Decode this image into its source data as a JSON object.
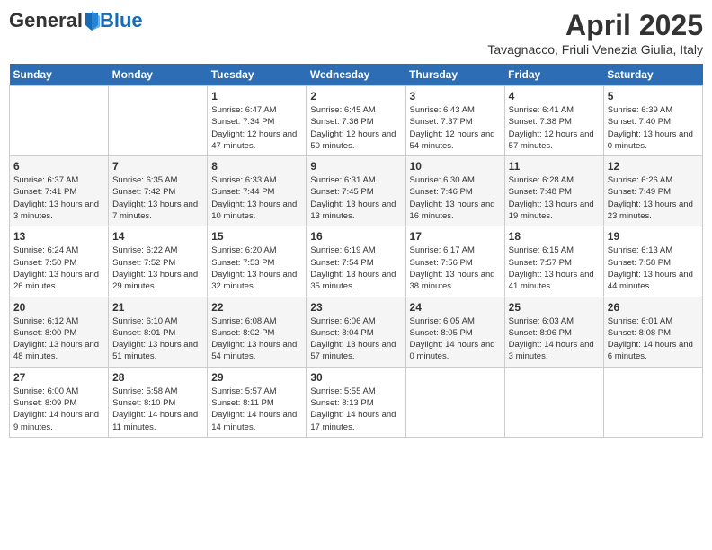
{
  "header": {
    "logo_general": "General",
    "logo_blue": "Blue",
    "month": "April 2025",
    "location": "Tavagnacco, Friuli Venezia Giulia, Italy"
  },
  "days_of_week": [
    "Sunday",
    "Monday",
    "Tuesday",
    "Wednesday",
    "Thursday",
    "Friday",
    "Saturday"
  ],
  "weeks": [
    [
      {
        "day": "",
        "info": ""
      },
      {
        "day": "",
        "info": ""
      },
      {
        "day": "1",
        "info": "Sunrise: 6:47 AM\nSunset: 7:34 PM\nDaylight: 12 hours and 47 minutes."
      },
      {
        "day": "2",
        "info": "Sunrise: 6:45 AM\nSunset: 7:36 PM\nDaylight: 12 hours and 50 minutes."
      },
      {
        "day": "3",
        "info": "Sunrise: 6:43 AM\nSunset: 7:37 PM\nDaylight: 12 hours and 54 minutes."
      },
      {
        "day": "4",
        "info": "Sunrise: 6:41 AM\nSunset: 7:38 PM\nDaylight: 12 hours and 57 minutes."
      },
      {
        "day": "5",
        "info": "Sunrise: 6:39 AM\nSunset: 7:40 PM\nDaylight: 13 hours and 0 minutes."
      }
    ],
    [
      {
        "day": "6",
        "info": "Sunrise: 6:37 AM\nSunset: 7:41 PM\nDaylight: 13 hours and 3 minutes."
      },
      {
        "day": "7",
        "info": "Sunrise: 6:35 AM\nSunset: 7:42 PM\nDaylight: 13 hours and 7 minutes."
      },
      {
        "day": "8",
        "info": "Sunrise: 6:33 AM\nSunset: 7:44 PM\nDaylight: 13 hours and 10 minutes."
      },
      {
        "day": "9",
        "info": "Sunrise: 6:31 AM\nSunset: 7:45 PM\nDaylight: 13 hours and 13 minutes."
      },
      {
        "day": "10",
        "info": "Sunrise: 6:30 AM\nSunset: 7:46 PM\nDaylight: 13 hours and 16 minutes."
      },
      {
        "day": "11",
        "info": "Sunrise: 6:28 AM\nSunset: 7:48 PM\nDaylight: 13 hours and 19 minutes."
      },
      {
        "day": "12",
        "info": "Sunrise: 6:26 AM\nSunset: 7:49 PM\nDaylight: 13 hours and 23 minutes."
      }
    ],
    [
      {
        "day": "13",
        "info": "Sunrise: 6:24 AM\nSunset: 7:50 PM\nDaylight: 13 hours and 26 minutes."
      },
      {
        "day": "14",
        "info": "Sunrise: 6:22 AM\nSunset: 7:52 PM\nDaylight: 13 hours and 29 minutes."
      },
      {
        "day": "15",
        "info": "Sunrise: 6:20 AM\nSunset: 7:53 PM\nDaylight: 13 hours and 32 minutes."
      },
      {
        "day": "16",
        "info": "Sunrise: 6:19 AM\nSunset: 7:54 PM\nDaylight: 13 hours and 35 minutes."
      },
      {
        "day": "17",
        "info": "Sunrise: 6:17 AM\nSunset: 7:56 PM\nDaylight: 13 hours and 38 minutes."
      },
      {
        "day": "18",
        "info": "Sunrise: 6:15 AM\nSunset: 7:57 PM\nDaylight: 13 hours and 41 minutes."
      },
      {
        "day": "19",
        "info": "Sunrise: 6:13 AM\nSunset: 7:58 PM\nDaylight: 13 hours and 44 minutes."
      }
    ],
    [
      {
        "day": "20",
        "info": "Sunrise: 6:12 AM\nSunset: 8:00 PM\nDaylight: 13 hours and 48 minutes."
      },
      {
        "day": "21",
        "info": "Sunrise: 6:10 AM\nSunset: 8:01 PM\nDaylight: 13 hours and 51 minutes."
      },
      {
        "day": "22",
        "info": "Sunrise: 6:08 AM\nSunset: 8:02 PM\nDaylight: 13 hours and 54 minutes."
      },
      {
        "day": "23",
        "info": "Sunrise: 6:06 AM\nSunset: 8:04 PM\nDaylight: 13 hours and 57 minutes."
      },
      {
        "day": "24",
        "info": "Sunrise: 6:05 AM\nSunset: 8:05 PM\nDaylight: 14 hours and 0 minutes."
      },
      {
        "day": "25",
        "info": "Sunrise: 6:03 AM\nSunset: 8:06 PM\nDaylight: 14 hours and 3 minutes."
      },
      {
        "day": "26",
        "info": "Sunrise: 6:01 AM\nSunset: 8:08 PM\nDaylight: 14 hours and 6 minutes."
      }
    ],
    [
      {
        "day": "27",
        "info": "Sunrise: 6:00 AM\nSunset: 8:09 PM\nDaylight: 14 hours and 9 minutes."
      },
      {
        "day": "28",
        "info": "Sunrise: 5:58 AM\nSunset: 8:10 PM\nDaylight: 14 hours and 11 minutes."
      },
      {
        "day": "29",
        "info": "Sunrise: 5:57 AM\nSunset: 8:11 PM\nDaylight: 14 hours and 14 minutes."
      },
      {
        "day": "30",
        "info": "Sunrise: 5:55 AM\nSunset: 8:13 PM\nDaylight: 14 hours and 17 minutes."
      },
      {
        "day": "",
        "info": ""
      },
      {
        "day": "",
        "info": ""
      },
      {
        "day": "",
        "info": ""
      }
    ]
  ]
}
